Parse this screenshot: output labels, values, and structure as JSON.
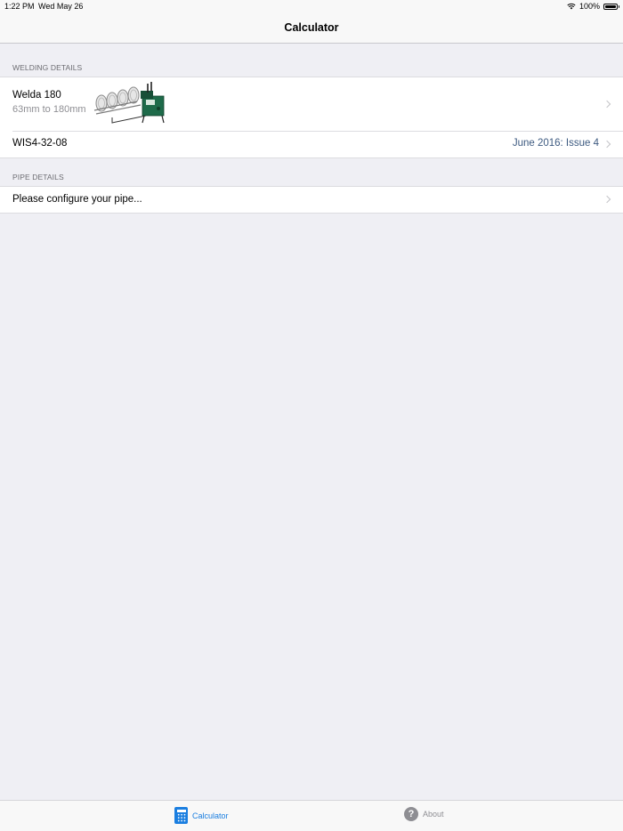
{
  "status_bar": {
    "time": "1:22 PM",
    "date": "Wed May 26",
    "battery": "100%"
  },
  "nav": {
    "title": "Calculator"
  },
  "sections": {
    "welding": {
      "header": "WELDING DETAILS",
      "machine": {
        "name": "Welda 180",
        "range": "63mm to 180mm"
      },
      "standard": {
        "label": "WIS4-32-08",
        "detail": "June 2016: Issue 4"
      }
    },
    "pipe": {
      "header": "PIPE DETAILS",
      "configure_label": "Please configure your pipe..."
    }
  },
  "tabs": [
    {
      "label": "Calculator",
      "icon": "calculator-icon",
      "selected": true
    },
    {
      "label": "About",
      "icon": "question-icon",
      "selected": false
    }
  ],
  "colors": {
    "accent": "#1a7ee0",
    "detail_text": "#3d5a80",
    "background": "#efeff4",
    "machine_green": "#1e6b4a"
  }
}
